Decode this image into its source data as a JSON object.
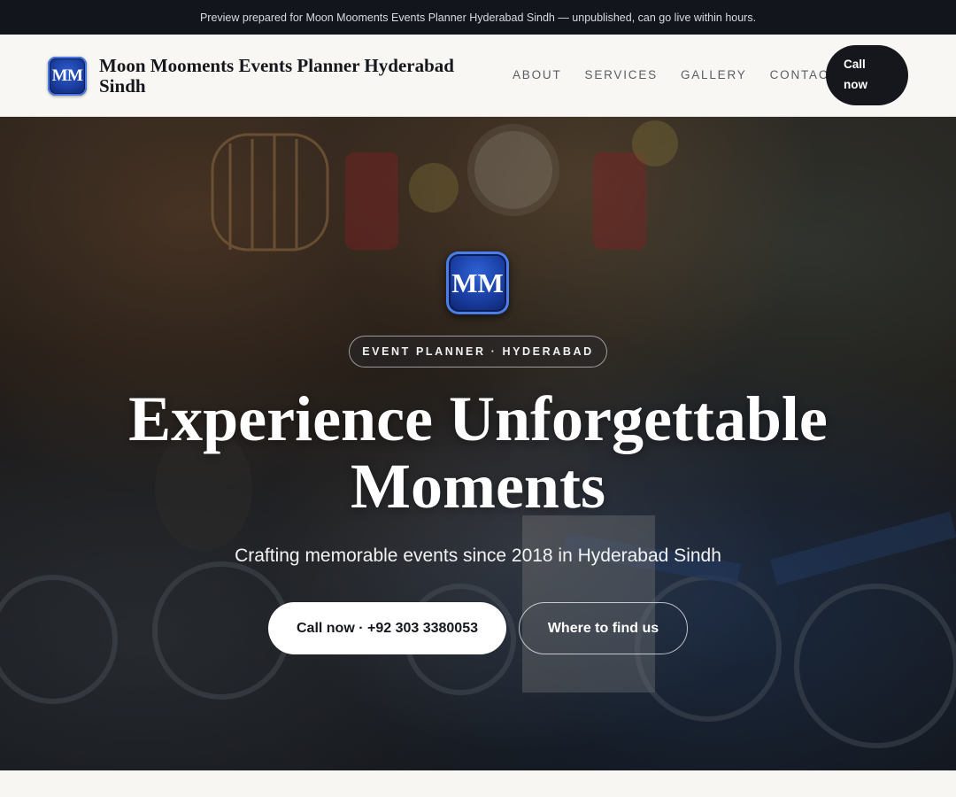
{
  "preview_banner": {
    "text": "Preview prepared for Moon Mooments Events Planner Hyderabad Sindh — unpublished, can go live within hours."
  },
  "header": {
    "logo_text": "MM",
    "brand_name": "Moon Mooments Events Planner Hyderabad Sindh",
    "nav": [
      {
        "label": "ABOUT"
      },
      {
        "label": "SERVICES"
      },
      {
        "label": "GALLERY"
      },
      {
        "label": "CONTACT"
      }
    ],
    "call_button": {
      "line1": "Call",
      "line2": "now"
    }
  },
  "hero": {
    "logo_text": "MM",
    "tag": "EVENT PLANNER · HYDERABAD",
    "title": "Experience Unforgettable Moments",
    "subtitle": "Crafting memorable events since 2018 in Hyderabad Sindh",
    "primary_button": "Call now · +92 303 3380053",
    "secondary_button": "Where to find us"
  },
  "colors": {
    "header_bg": "#f8f7f4",
    "preview_bar_bg": "#12151c",
    "dark_button": "#15171c",
    "logo_blue": "#1a3fa4"
  }
}
